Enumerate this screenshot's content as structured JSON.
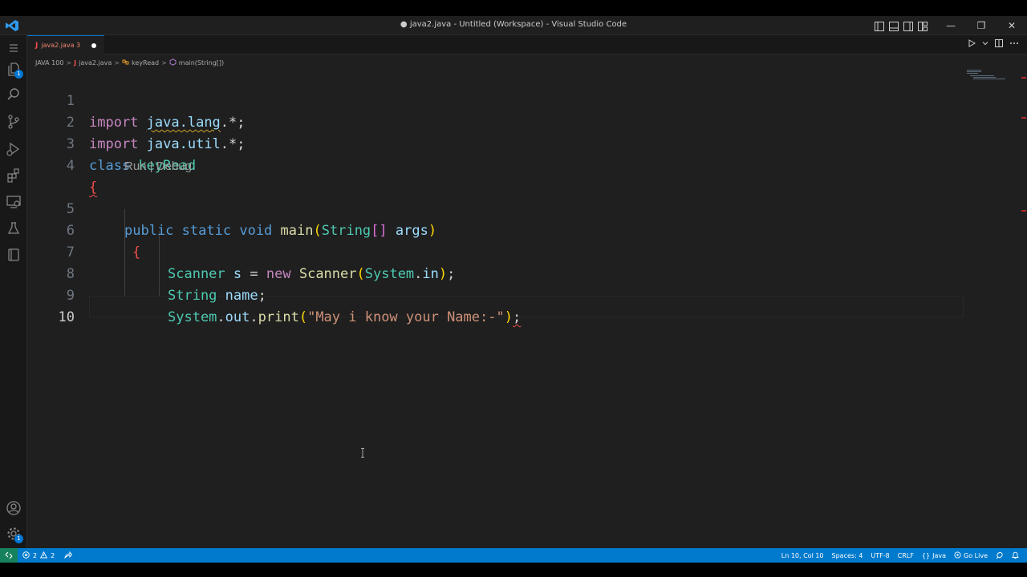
{
  "window": {
    "title": "● java2.java - Untitled (Workspace) - Visual Studio Code",
    "controls": {
      "minimize": "—",
      "restore": "❐",
      "close": "✕"
    }
  },
  "activity_bar": {
    "explorer_badge": "1",
    "manage_badge": "1"
  },
  "tab": {
    "icon": "J",
    "label": "java2.java 3"
  },
  "breadcrumb": {
    "items": [
      "JAVA 100",
      "java2.java",
      "keyRead",
      "main(String[])"
    ],
    "file_icon": "J",
    "separator": ">"
  },
  "editor": {
    "codelens": "Run | Debug",
    "line_numbers": [
      "1",
      "2",
      "3",
      "4",
      "5",
      "6",
      "7",
      "8",
      "9",
      "10"
    ],
    "current_line": "10",
    "lines": {
      "l1": {
        "kw": "import",
        "sp": " ",
        "pkg": "java.lang",
        "rest": ".*;"
      },
      "l2": {
        "kw": "import",
        "sp": " ",
        "pkg": "java.util",
        "rest": ".*;"
      },
      "l3": {
        "kw": "class",
        "sp": " ",
        "name": "keyRead"
      },
      "l4": {
        "brace": "{"
      },
      "l5": {
        "pub": "public",
        "static": "static",
        "void": "void",
        "fn": "main",
        "open": "(",
        "type": "String",
        "arr": "[]",
        "arg": "args",
        "close": ")"
      },
      "l6": {
        "brace": "{"
      },
      "l7": {
        "t1": "Scanner",
        "v": "s",
        "eq": " = ",
        "new": "new",
        "t2": "Scanner",
        "open": "(",
        "sys": "System",
        "dot": ".",
        "in": "in",
        "close": ")",
        "semi": ";"
      },
      "l8": {
        "t": "String",
        "v": "name",
        "semi": ";"
      },
      "l9": {
        "sys": "System",
        "dot1": ".",
        "out": "out",
        "dot2": ".",
        "fn": "print",
        "open": "(",
        "str": "\"May i know your Name:-\"",
        "close": ")",
        "semi": ";"
      }
    }
  },
  "status_bar": {
    "errors": "2",
    "warnings": "2",
    "position": "Ln 10, Col 10",
    "spaces": "Spaces: 4",
    "encoding": "UTF-8",
    "eol": "CRLF",
    "language": "Java",
    "go_live": "Go Live"
  },
  "colors": {
    "accent": "#007acc",
    "remote": "#16825d",
    "error": "#f14c4c"
  }
}
